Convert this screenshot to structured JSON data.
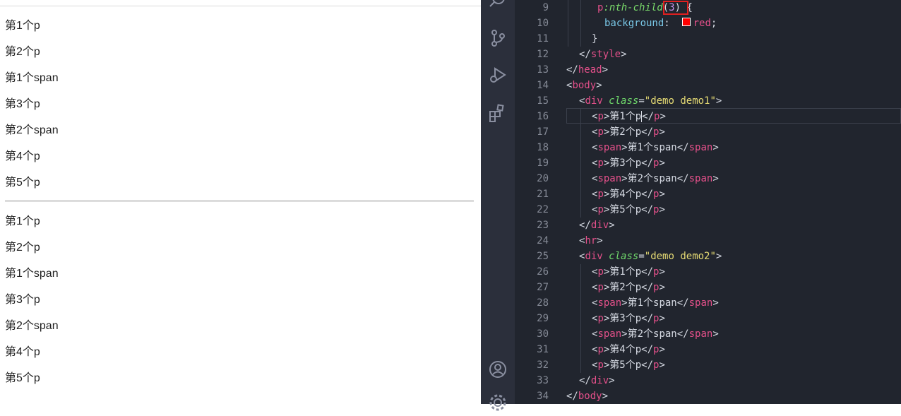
{
  "preview": {
    "group1": [
      "第1个p",
      "第2个p",
      "第1个span",
      "第3个p",
      "第2个span",
      "第4个p",
      "第5个p"
    ],
    "group2": [
      "第1个p",
      "第2个p",
      "第1个span",
      "第3个p",
      "第2个span",
      "第4个p",
      "第5个p"
    ]
  },
  "activity_bar": {
    "icons": [
      "search-icon",
      "source-control-icon",
      "run-debug-icon",
      "extensions-icon",
      "account-icon",
      "settings-gear-icon"
    ]
  },
  "editor": {
    "swatch_color": "#ff0000",
    "lines": [
      {
        "n": "9",
        "tokens": [
          [
            "sel",
            "p"
          ],
          [
            "ps",
            ":nth-child"
          ],
          [
            "plain",
            "("
          ],
          [
            "num",
            "3"
          ],
          [
            "plain",
            ") {"
          ]
        ]
      },
      {
        "n": "10",
        "tokens": [
          [
            "prop",
            "background"
          ],
          [
            "plain",
            ":  "
          ],
          [
            "swatch",
            ""
          ],
          [
            "val",
            "red"
          ],
          [
            "plain",
            ";"
          ]
        ]
      },
      {
        "n": "11",
        "tokens": [
          [
            "plain",
            "}"
          ]
        ]
      },
      {
        "n": "12",
        "tokens": [
          [
            "plain",
            "</"
          ],
          [
            "t",
            "style"
          ],
          [
            "plain",
            ">"
          ]
        ]
      },
      {
        "n": "13",
        "tokens": [
          [
            "plain",
            "</"
          ],
          [
            "t",
            "head"
          ],
          [
            "plain",
            ">"
          ]
        ]
      },
      {
        "n": "14",
        "tokens": [
          [
            "plain",
            "<"
          ],
          [
            "t",
            "body"
          ],
          [
            "plain",
            ">"
          ]
        ]
      },
      {
        "n": "15",
        "tokens": [
          [
            "plain",
            "<"
          ],
          [
            "t",
            "div"
          ],
          [
            "plain",
            " "
          ],
          [
            "a",
            "class"
          ],
          [
            "plain",
            "="
          ],
          [
            "s",
            "\"demo demo1\""
          ],
          [
            "plain",
            ">"
          ]
        ]
      },
      {
        "n": "16",
        "tokens": [
          [
            "plain",
            "<"
          ],
          [
            "t",
            "p"
          ],
          [
            "plain",
            ">第1个p"
          ],
          [
            "caret",
            ""
          ],
          [
            "plain",
            "</"
          ],
          [
            "t",
            "p"
          ],
          [
            "plain",
            ">"
          ]
        ]
      },
      {
        "n": "17",
        "tokens": [
          [
            "plain",
            "<"
          ],
          [
            "t",
            "p"
          ],
          [
            "plain",
            ">第2个p</"
          ],
          [
            "t",
            "p"
          ],
          [
            "plain",
            ">"
          ]
        ]
      },
      {
        "n": "18",
        "tokens": [
          [
            "plain",
            "<"
          ],
          [
            "t",
            "span"
          ],
          [
            "plain",
            ">第1个span</"
          ],
          [
            "t",
            "span"
          ],
          [
            "plain",
            ">"
          ]
        ]
      },
      {
        "n": "19",
        "tokens": [
          [
            "plain",
            "<"
          ],
          [
            "t",
            "p"
          ],
          [
            "plain",
            ">第3个p</"
          ],
          [
            "t",
            "p"
          ],
          [
            "plain",
            ">"
          ]
        ]
      },
      {
        "n": "20",
        "tokens": [
          [
            "plain",
            "<"
          ],
          [
            "t",
            "span"
          ],
          [
            "plain",
            ">第2个span</"
          ],
          [
            "t",
            "span"
          ],
          [
            "plain",
            ">"
          ]
        ]
      },
      {
        "n": "21",
        "tokens": [
          [
            "plain",
            "<"
          ],
          [
            "t",
            "p"
          ],
          [
            "plain",
            ">第4个p</"
          ],
          [
            "t",
            "p"
          ],
          [
            "plain",
            ">"
          ]
        ]
      },
      {
        "n": "22",
        "tokens": [
          [
            "plain",
            "<"
          ],
          [
            "t",
            "p"
          ],
          [
            "plain",
            ">第5个p</"
          ],
          [
            "t",
            "p"
          ],
          [
            "plain",
            ">"
          ]
        ]
      },
      {
        "n": "23",
        "tokens": [
          [
            "plain",
            "</"
          ],
          [
            "t",
            "div"
          ],
          [
            "plain",
            ">"
          ]
        ]
      },
      {
        "n": "24",
        "tokens": [
          [
            "plain",
            "<"
          ],
          [
            "t",
            "hr"
          ],
          [
            "plain",
            ">"
          ]
        ]
      },
      {
        "n": "25",
        "tokens": [
          [
            "plain",
            "<"
          ],
          [
            "t",
            "div"
          ],
          [
            "plain",
            " "
          ],
          [
            "a",
            "class"
          ],
          [
            "plain",
            "="
          ],
          [
            "s",
            "\"demo demo2\""
          ],
          [
            "plain",
            ">"
          ]
        ]
      },
      {
        "n": "26",
        "tokens": [
          [
            "plain",
            "<"
          ],
          [
            "t",
            "p"
          ],
          [
            "plain",
            ">第1个p</"
          ],
          [
            "t",
            "p"
          ],
          [
            "plain",
            ">"
          ]
        ]
      },
      {
        "n": "27",
        "tokens": [
          [
            "plain",
            "<"
          ],
          [
            "t",
            "p"
          ],
          [
            "plain",
            ">第2个p</"
          ],
          [
            "t",
            "p"
          ],
          [
            "plain",
            ">"
          ]
        ]
      },
      {
        "n": "28",
        "tokens": [
          [
            "plain",
            "<"
          ],
          [
            "t",
            "span"
          ],
          [
            "plain",
            ">第1个span</"
          ],
          [
            "t",
            "span"
          ],
          [
            "plain",
            ">"
          ]
        ]
      },
      {
        "n": "29",
        "tokens": [
          [
            "plain",
            "<"
          ],
          [
            "t",
            "p"
          ],
          [
            "plain",
            ">第3个p</"
          ],
          [
            "t",
            "p"
          ],
          [
            "plain",
            ">"
          ]
        ]
      },
      {
        "n": "30",
        "tokens": [
          [
            "plain",
            "<"
          ],
          [
            "t",
            "span"
          ],
          [
            "plain",
            ">第2个span</"
          ],
          [
            "t",
            "span"
          ],
          [
            "plain",
            ">"
          ]
        ]
      },
      {
        "n": "31",
        "tokens": [
          [
            "plain",
            "<"
          ],
          [
            "t",
            "p"
          ],
          [
            "plain",
            ">第4个p</"
          ],
          [
            "t",
            "p"
          ],
          [
            "plain",
            ">"
          ]
        ]
      },
      {
        "n": "32",
        "tokens": [
          [
            "plain",
            "<"
          ],
          [
            "t",
            "p"
          ],
          [
            "plain",
            ">第5个p</"
          ],
          [
            "t",
            "p"
          ],
          [
            "plain",
            ">"
          ]
        ]
      },
      {
        "n": "33",
        "tokens": [
          [
            "plain",
            "</"
          ],
          [
            "t",
            "div"
          ],
          [
            "plain",
            ">"
          ]
        ]
      },
      {
        "n": "34",
        "tokens": [
          [
            "plain",
            "</"
          ],
          [
            "t",
            "body"
          ],
          [
            "plain",
            ">"
          ]
        ]
      }
    ]
  }
}
